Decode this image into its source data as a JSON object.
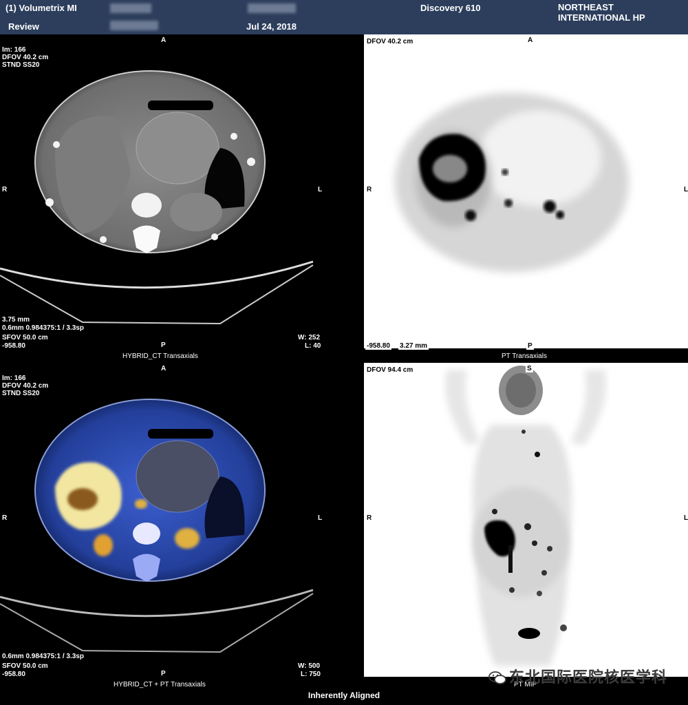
{
  "header": {
    "series_name": "(1) Volumetrix MI",
    "mode": "Review",
    "date": "Jul 24, 2018",
    "scanner": "Discovery 610",
    "hospital_line1": "NORTHEAST",
    "hospital_line2": "INTERNATIONAL HP"
  },
  "ct_panel": {
    "im": "Im: 166",
    "dfov": "DFOV 40.2 cm",
    "recon": "STND SS20",
    "orient_top": "A",
    "orient_bottom": "P",
    "orient_left": "R",
    "orient_right": "L",
    "slice_thickness": "3.75 mm",
    "pitch": "0.6mm 0.984375:1 / 3.3sp",
    "sfov": "SFOV 50.0 cm",
    "location": "-958.80",
    "window_width": "W: 252",
    "window_level": "L: 40",
    "caption": "HYBRID_CT Transaxials"
  },
  "pt_panel": {
    "dfov": "DFOV 40.2 cm",
    "orient_top": "A",
    "orient_bottom": "P",
    "orient_left": "R",
    "orient_right": "L",
    "location": "-958.80",
    "thickness": "3.27 mm",
    "caption": "PT Transaxials"
  },
  "fusion_panel": {
    "im": "Im: 166",
    "dfov": "DFOV 40.2 cm",
    "recon": "STND SS20",
    "orient_top": "A",
    "orient_bottom": "P",
    "orient_left": "R",
    "orient_right": "L",
    "pitch": "0.6mm 0.984375:1 / 3.3sp",
    "sfov": "SFOV 50.0 cm",
    "location": "-958.80",
    "window_width": "W: 500",
    "window_level": "L: 750",
    "caption": "HYBRID_CT + PT Transaxials"
  },
  "mip_panel": {
    "dfov": "DFOV 94.4 cm",
    "orient_top": "S",
    "orient_left": "R",
    "orient_right": "L",
    "caption": "PT MIP"
  },
  "footer": {
    "alignment": "Inherently Aligned"
  },
  "watermark": {
    "text": "东北国际医院核医学科",
    "icon": "wechat-icon"
  },
  "colors": {
    "header_bg": "#2c3e5c",
    "fusion_hot": "#f2e6a0",
    "fusion_blue": "#2a5bd8"
  }
}
